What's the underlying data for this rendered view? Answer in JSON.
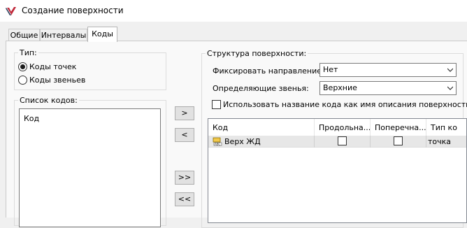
{
  "window": {
    "title": "Создание поверхности"
  },
  "tabs": [
    {
      "label": "Общие"
    },
    {
      "label": "Интервалы"
    },
    {
      "label": "Коды"
    }
  ],
  "active_tab": "Коды",
  "type_group": {
    "legend": "Тип:",
    "options": [
      {
        "label": "Коды точек",
        "selected": true
      },
      {
        "label": "Коды звеньев",
        "selected": false
      }
    ]
  },
  "code_list": {
    "legend": "Список кодов:",
    "items": [
      "Код"
    ]
  },
  "transfer_buttons": {
    "add": ">",
    "remove": "<",
    "add_all": ">>",
    "remove_all": "<<"
  },
  "structure": {
    "legend": "Структура поверхности:",
    "fix_direction": {
      "label": "Фиксировать направление:",
      "value": "Нет"
    },
    "defining_links": {
      "label": "Определяющие звенья:",
      "value": "Верхние"
    },
    "use_code_name": {
      "label": "Использовать название кода как имя описания поверхности",
      "checked": false
    },
    "table": {
      "columns": [
        "Код",
        "Продольна...",
        "Поперечна...",
        "Тип ко"
      ],
      "rows": [
        {
          "code": "Верх ЖД",
          "longitudinal": false,
          "transverse": false,
          "type": "точка",
          "icon": "surface-code-icon"
        }
      ]
    }
  },
  "colors": {
    "accent_red": "#c0283a",
    "accent_dark": "#2a3f5c",
    "row_highlight": "#e7e7e7"
  }
}
